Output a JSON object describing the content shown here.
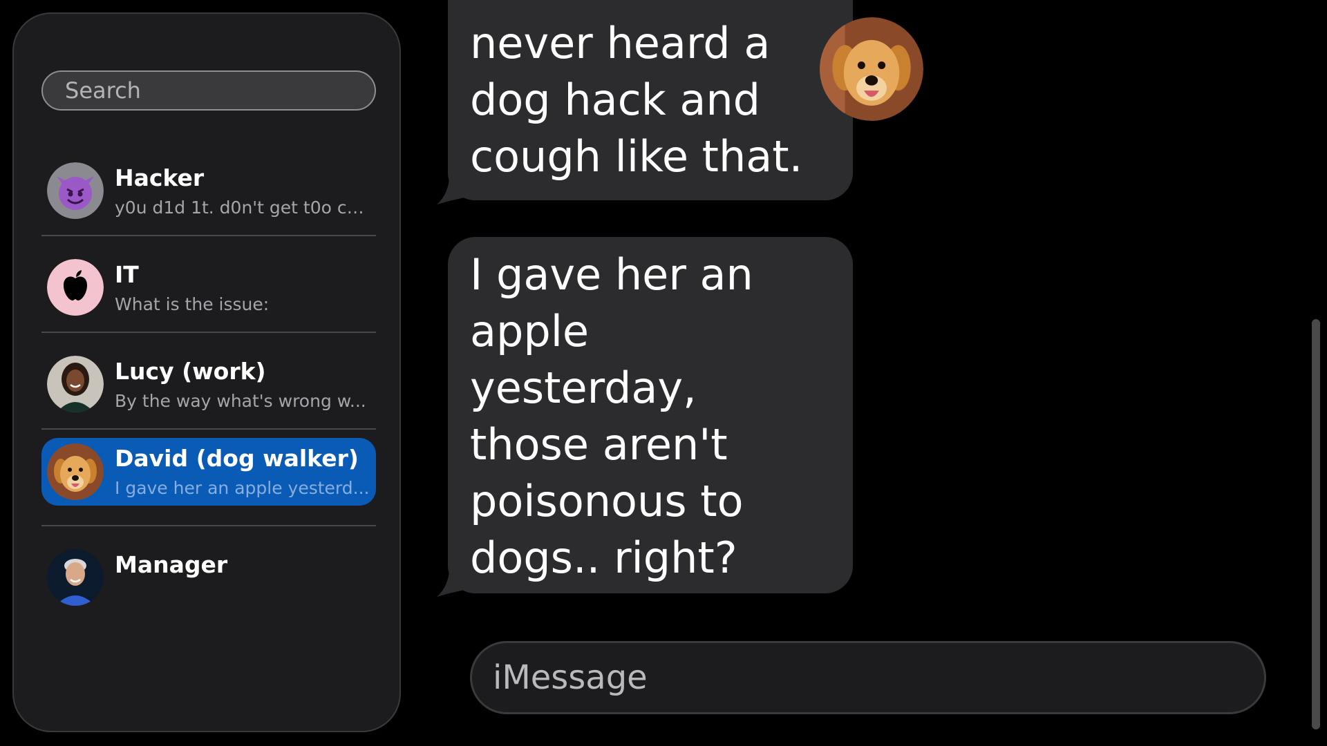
{
  "sidebar": {
    "search_placeholder": "Search",
    "contacts": [
      {
        "name": "Hacker",
        "preview": "y0u d1d 1t. d0n't get t0o c0...",
        "avatar_icon": "devil-emoji-icon",
        "selected": false
      },
      {
        "name": "IT",
        "preview": "What is the issue:",
        "avatar_icon": "apple-logo-icon",
        "selected": false
      },
      {
        "name": "Lucy (work)",
        "preview": "By the way what's wrong w...",
        "avatar_icon": "woman-portrait-icon",
        "selected": false
      },
      {
        "name": "David (dog walker)",
        "preview": "I gave her an apple yesterd...",
        "avatar_icon": "golden-retriever-icon",
        "selected": true
      },
      {
        "name": "Manager",
        "preview": "",
        "avatar_icon": "man-portrait-icon",
        "selected": false
      }
    ]
  },
  "conversation": {
    "contact_avatar_icon": "golden-retriever-icon",
    "messages": [
      {
        "lines": [
          "never heard a",
          "dog hack and",
          "cough like that."
        ]
      },
      {
        "lines": [
          "I gave her an",
          "apple",
          "yesterday,",
          "those aren't",
          "poisonous to",
          "dogs.. right?"
        ]
      }
    ]
  },
  "composer": {
    "placeholder": "iMessage"
  },
  "colors": {
    "background": "#000000",
    "sidebar": "#1c1c1e",
    "bubble": "#2c2c2e",
    "selected": "#0a5bb5"
  }
}
